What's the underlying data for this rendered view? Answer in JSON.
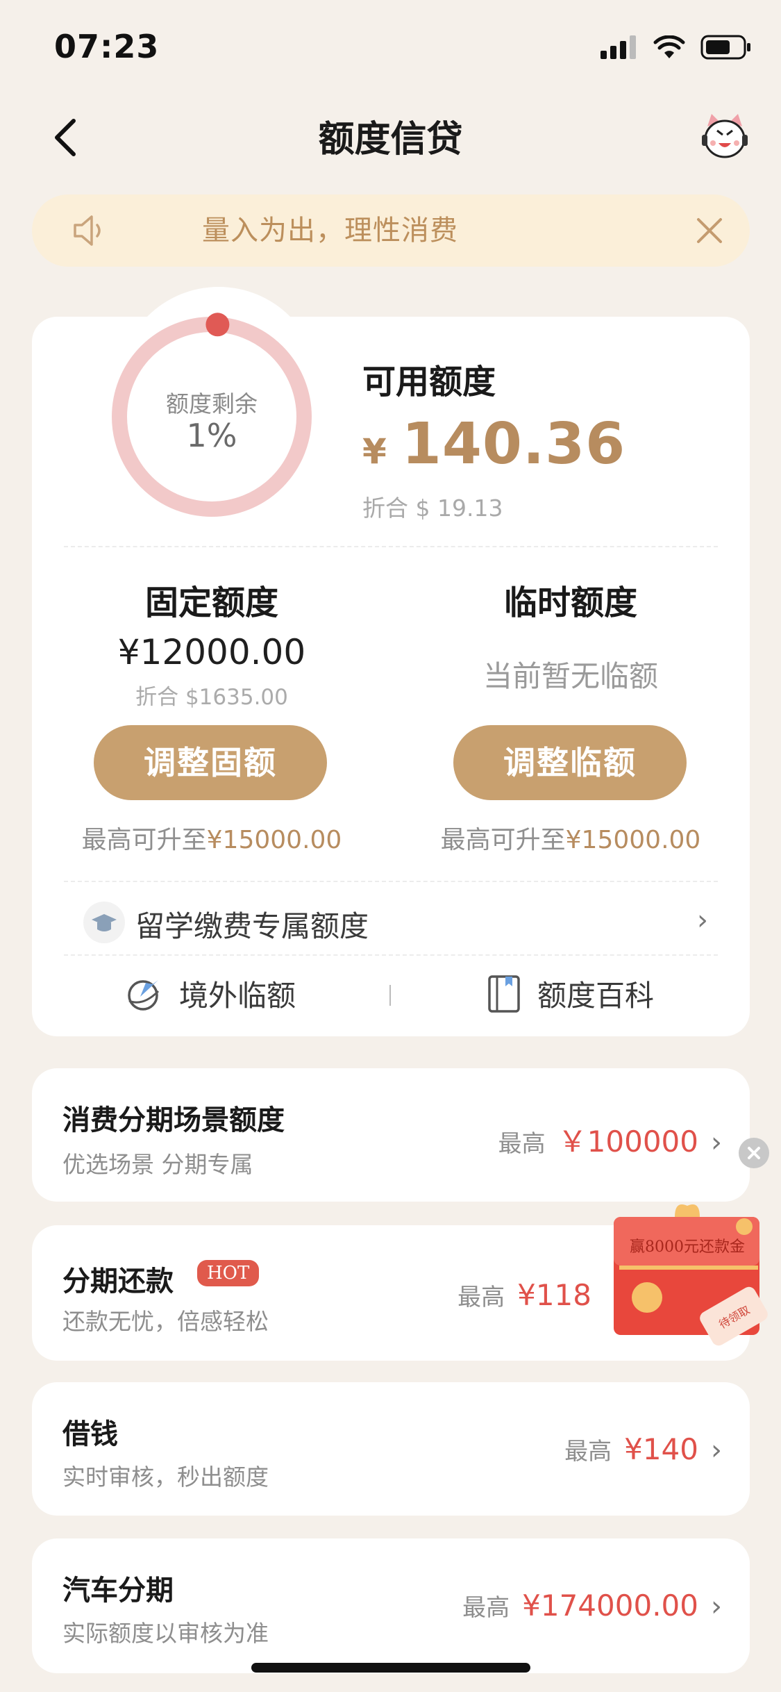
{
  "status_bar": {
    "time": "07:23"
  },
  "nav": {
    "title": "额度信贷"
  },
  "notice": {
    "text": "量入为出，理性消费"
  },
  "ring": {
    "label": "额度剩余",
    "value": "1%",
    "remaining_fraction": 0.01
  },
  "available": {
    "label": "可用额度",
    "currency": "¥",
    "amount": "140.36",
    "converted": "折合 $ 19.13"
  },
  "fixed": {
    "title": "固定额度",
    "amount": "¥12000.00",
    "converted": "折合 $1635.00",
    "button": "调整固额",
    "max_prefix": "最高可升至",
    "max_value": "¥15000.00"
  },
  "temporary": {
    "title": "临时额度",
    "status": "当前暂无临额",
    "button": "调整临额",
    "max_prefix": "最高可升至",
    "max_value": "¥15000.00"
  },
  "study": {
    "label": "留学缴费专属额度"
  },
  "links": {
    "overseas": "境外临额",
    "wiki": "额度百科"
  },
  "cards": [
    {
      "title": "消费分期场景额度",
      "subtitle": "优选场景 分期专属",
      "prefix": "最高",
      "value": "￥100000"
    },
    {
      "title": "分期还款",
      "badge": "HOT",
      "subtitle": "还款无忧，倍感轻松",
      "prefix": "最高",
      "value": "¥118"
    },
    {
      "title": "借钱",
      "subtitle": "实时审核，秒出额度",
      "prefix": "最高",
      "value": "¥140"
    },
    {
      "title": "汽车分期",
      "subtitle": "实际额度以审核为准",
      "prefix": "最高",
      "value": "¥174000.00"
    }
  ],
  "promo": {
    "text": "赢8000元还款金",
    "stamp": "待领取"
  },
  "colors": {
    "gold": "#c8a06f",
    "red": "#e0514a",
    "ring": "#f2c9c9",
    "ring_dot": "#e05a55"
  }
}
